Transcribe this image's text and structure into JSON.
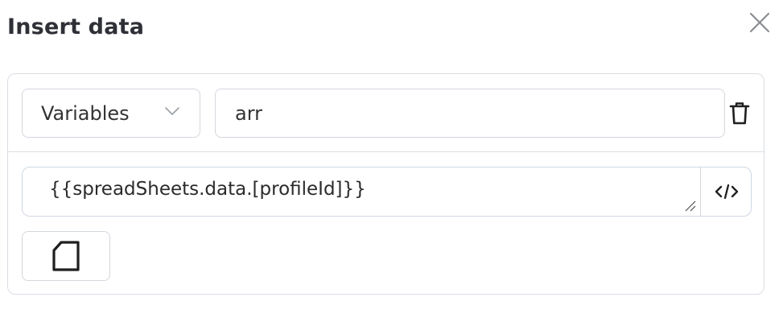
{
  "dialog": {
    "title": "Insert data",
    "close_icon": "close-icon"
  },
  "row": {
    "type_select": {
      "selected": "Variables",
      "icon": "chevron-down-icon"
    },
    "name_input": {
      "value": "arr"
    },
    "delete_icon": "trash-icon"
  },
  "value": {
    "text": "{{spreadSheets.data.[profileId]}}",
    "code_icon": "code-icon"
  },
  "add_button": {
    "icon": "document-icon"
  }
}
